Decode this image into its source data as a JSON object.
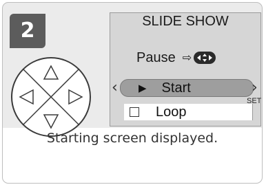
{
  "step": {
    "number": "2"
  },
  "lcd": {
    "title": "SLIDE SHOW",
    "pause_label": "Pause",
    "pause_arrow": "⇨",
    "start_label": "Start",
    "set_label": "SET",
    "loop_label": "Loop"
  },
  "caption": "Starting screen displayed.",
  "colors": {
    "card_bg": "#ebebeb",
    "badge": "#5c5c5c",
    "lcd_bg": "#d6d6d6",
    "highlight": "#9e9e9e"
  },
  "icons": {
    "multi_selector": "multi-selector-icon",
    "play": "play-icon",
    "checkbox": "checkbox-icon"
  }
}
